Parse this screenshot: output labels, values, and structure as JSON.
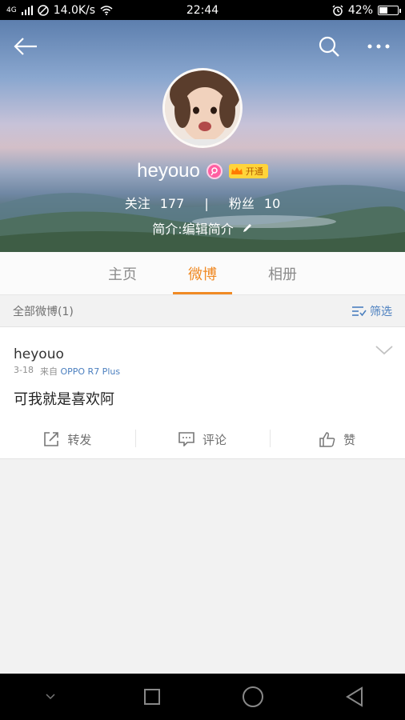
{
  "status_bar": {
    "network": "4G",
    "speed": "14.0K/s",
    "time": "22:44",
    "battery_percent": "42%",
    "battery_level": 0.42
  },
  "header": {
    "nickname": "heyouo",
    "vip_badge_label": "开通",
    "follow_label": "关注",
    "follow_count": "177",
    "separator": "|",
    "fans_label": "粉丝",
    "fans_count": "10",
    "bio": "简介:编辑简介"
  },
  "tabs": [
    {
      "label": "主页",
      "active": false
    },
    {
      "label": "微博",
      "active": true
    },
    {
      "label": "相册",
      "active": false
    }
  ],
  "filter": {
    "title": "全部微博(1)",
    "button_label": "筛选"
  },
  "post": {
    "author": "heyouo",
    "date": "3-18",
    "from_label": "来自",
    "source": "OPPO R7 Plus",
    "text": "可我就是喜欢阿",
    "actions": [
      {
        "label": "转发",
        "icon": "repost-icon"
      },
      {
        "label": "评论",
        "icon": "comment-icon"
      },
      {
        "label": "赞",
        "icon": "like-icon"
      }
    ]
  },
  "colors": {
    "accent": "#f08a24",
    "link": "#4b7fbf"
  }
}
